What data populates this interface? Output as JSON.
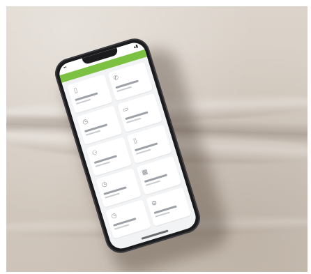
{
  "photo": {
    "description_colors": {
      "fabric": "#d4cbc1",
      "phone_body": "#1b1b1d",
      "accent_bar": "#7cc142"
    }
  },
  "app": {
    "tiles": [
      {
        "icon": "document-icon"
      },
      {
        "icon": "phone-icon"
      },
      {
        "icon": "clock-icon"
      },
      {
        "icon": "card-icon"
      },
      {
        "icon": "people-icon"
      },
      {
        "icon": "phone-device-icon"
      },
      {
        "icon": "clock-icon"
      },
      {
        "icon": "calendar-icon"
      },
      {
        "icon": "clock-icon"
      },
      {
        "icon": "settings-icon"
      }
    ]
  }
}
